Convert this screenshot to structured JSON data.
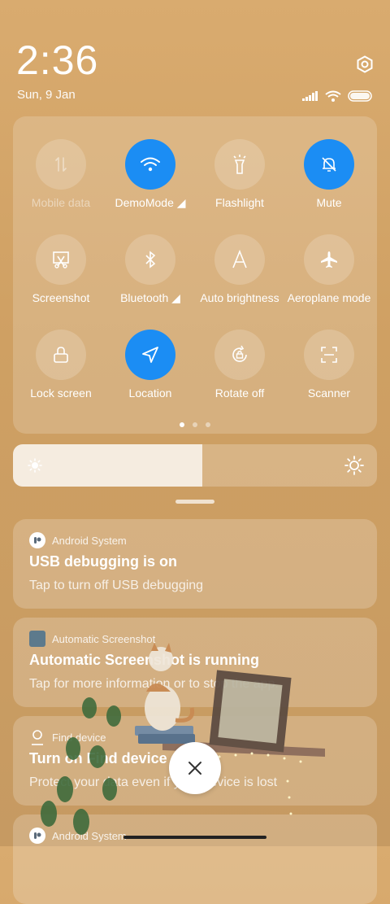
{
  "status_bar": {
    "time": "2:36",
    "date": "Sun, 9 Jan"
  },
  "quick_settings": {
    "tiles": [
      {
        "id": "mobile-data",
        "label": "Mobile data",
        "state": "disabled",
        "icon": "mobile-data-icon"
      },
      {
        "id": "wifi",
        "label": "DemoMode ◢",
        "state": "on",
        "icon": "wifi-icon"
      },
      {
        "id": "flashlight",
        "label": "Flashlight",
        "state": "off",
        "icon": "flashlight-icon"
      },
      {
        "id": "mute",
        "label": "Mute",
        "state": "on",
        "icon": "bell-off-icon"
      },
      {
        "id": "screenshot",
        "label": "Screenshot",
        "state": "off",
        "icon": "scissors-icon"
      },
      {
        "id": "bluetooth",
        "label": "Bluetooth ◢",
        "state": "off",
        "icon": "bluetooth-icon"
      },
      {
        "id": "auto-brightness",
        "label": "Auto brightness",
        "state": "off",
        "icon": "auto-brightness-icon"
      },
      {
        "id": "aeroplane",
        "label": "Aeroplane mode",
        "state": "off",
        "icon": "airplane-icon"
      },
      {
        "id": "lock-screen",
        "label": "Lock screen",
        "state": "off",
        "icon": "lock-icon"
      },
      {
        "id": "location",
        "label": "Location",
        "state": "on",
        "icon": "location-arrow-icon"
      },
      {
        "id": "rotate",
        "label": "Rotate off",
        "state": "off",
        "icon": "rotate-lock-icon"
      },
      {
        "id": "scanner",
        "label": "Scanner",
        "state": "off",
        "icon": "scanner-icon"
      }
    ],
    "active_color": "#1b8df4",
    "page_count": 3,
    "active_page": 1
  },
  "brightness": {
    "level_percent": 52
  },
  "notifications": [
    {
      "app": "Android System",
      "title": "USB debugging is on",
      "body": "Tap to turn off USB debugging",
      "icon": "android-system-icon"
    },
    {
      "app": "Automatic Screenshot",
      "title": "Automatic Screenshot is running",
      "body": "Tap for more information or to stop the app.",
      "icon": "screenshot-app-icon"
    },
    {
      "app": "Find device",
      "title": "Turn on Find device",
      "body": "Protect your data even if your device is lost",
      "icon": "find-device-icon"
    },
    {
      "app": "Android System",
      "title": "",
      "body": "",
      "icon": "android-system-icon"
    }
  ]
}
